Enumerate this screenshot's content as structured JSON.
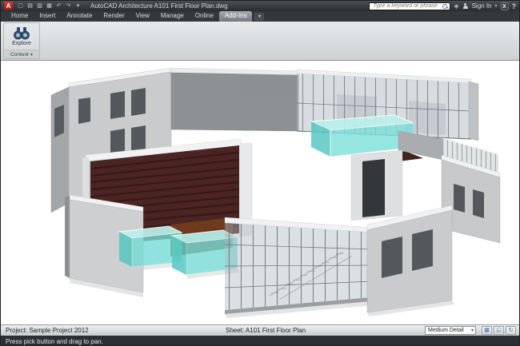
{
  "titlebar": {
    "logo_glyph": "A",
    "qat_icons": [
      {
        "name": "new-icon",
        "glyph": "▢"
      },
      {
        "name": "open-icon",
        "glyph": "▤"
      },
      {
        "name": "save-icon",
        "glyph": "▥"
      },
      {
        "name": "plot-icon",
        "glyph": "▦"
      },
      {
        "name": "undo-icon",
        "glyph": "↶"
      },
      {
        "name": "redo-icon",
        "glyph": "↷"
      },
      {
        "name": "qat-dropdown-icon",
        "glyph": "▾"
      }
    ],
    "title": "AutoCAD Architecture  A101 First Floor Plan.dwg",
    "search_placeholder": "Type a keyword or phrase",
    "comm_center_glyph": "◈",
    "signin_label": "Sign In",
    "signin_caret": "▾",
    "exchange_glyph": "X",
    "help_glyph": "?"
  },
  "menubar": {
    "tabs": [
      {
        "label": "Home"
      },
      {
        "label": "Insert"
      },
      {
        "label": "Annotate"
      },
      {
        "label": "Render"
      },
      {
        "label": "View"
      },
      {
        "label": "Manage"
      },
      {
        "label": "Online"
      },
      {
        "label": "Add-Ins"
      }
    ],
    "active_tab": "Add-Ins",
    "overflow_glyph": "▾"
  },
  "ribbon": {
    "explore_label": "Explore",
    "panel_label": "Content",
    "panel_caret": "▾"
  },
  "statusbar": {
    "project_label": "Project: Sample Project 2012",
    "sheet_label": "Sheet: A101 First Floor Plan",
    "detail_value": "Medium Detail",
    "detail_caret": "▾",
    "icons": [
      {
        "name": "display-config-icon",
        "glyph": "▦"
      },
      {
        "name": "cut-plane-icon",
        "glyph": "◱"
      },
      {
        "name": "regen-icon",
        "glyph": "↻"
      }
    ]
  },
  "commandbar": {
    "message": "Press pick button and drag to pan."
  },
  "colors": {
    "teal_glass": "#5fc9c4",
    "wall_gray": "#c9cbcd",
    "floor_maroon": "#4b2523",
    "wood_brown": "#6e3b1e",
    "titlebar_dark": "#2c2f32"
  }
}
